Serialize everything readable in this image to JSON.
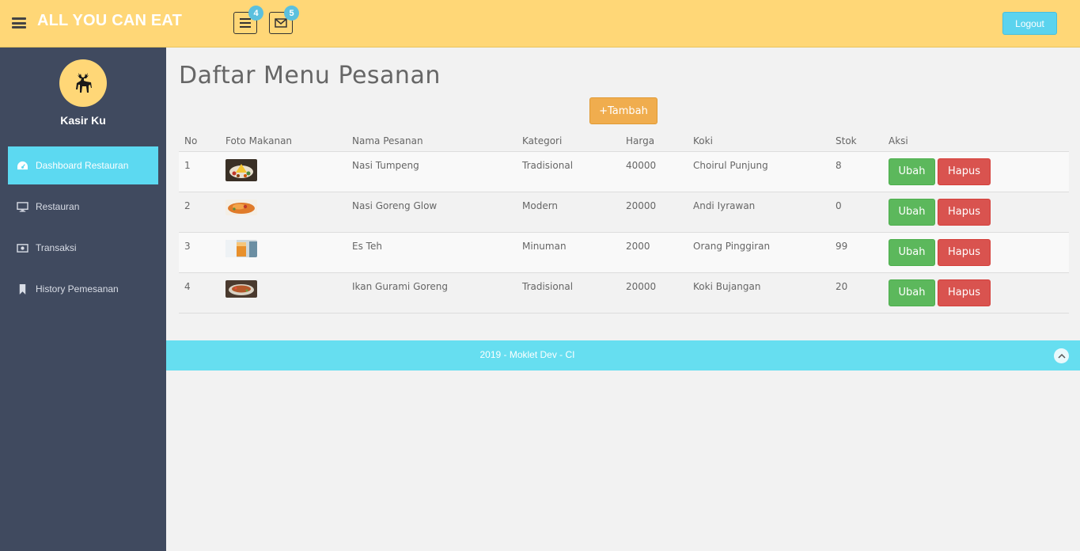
{
  "header": {
    "brand": "ALL YOU CAN EAT",
    "menu_icon": "hamburger-icon",
    "list_icon": "list-icon",
    "list_badge": "4",
    "mail_icon": "envelope-icon",
    "mail_badge": "5",
    "logout_label": "Logout"
  },
  "sidebar": {
    "avatar_icon": "deer-icon",
    "user_name": "Kasir Ku",
    "items": [
      {
        "label": "Dashboard Restauran",
        "icon": "dashboard-icon",
        "active": true
      },
      {
        "label": "Restauran",
        "icon": "monitor-icon",
        "active": false
      },
      {
        "label": "Transaksi",
        "icon": "money-icon",
        "active": false
      },
      {
        "label": "History Pemesanan",
        "icon": "bookmark-icon",
        "active": false
      }
    ]
  },
  "main": {
    "title": "Daftar Menu Pesanan",
    "add_label": "+Tambah",
    "table": {
      "headers": [
        "No",
        "Foto Makanan",
        "Nama Pesanan",
        "Kategori",
        "Harga",
        "Koki",
        "Stok",
        "Aksi"
      ],
      "rows": [
        {
          "no": "1",
          "nama": "Nasi Tumpeng",
          "kategori": "Tradisional",
          "harga": "40000",
          "koki": "Choirul Punjung",
          "stok": "8"
        },
        {
          "no": "2",
          "nama": "Nasi Goreng Glow",
          "kategori": "Modern",
          "harga": "20000",
          "koki": "Andi Iyrawan",
          "stok": "0"
        },
        {
          "no": "3",
          "nama": "Es Teh",
          "kategori": "Minuman",
          "harga": "2000",
          "koki": "Orang Pinggiran",
          "stok": "99"
        },
        {
          "no": "4",
          "nama": "Ikan Gurami Goreng",
          "kategori": "Tradisional",
          "harga": "20000",
          "koki": "Koki Bujangan",
          "stok": "20"
        }
      ],
      "edit_label": "Ubah",
      "delete_label": "Hapus"
    }
  },
  "footer": {
    "text": "2019 - Moklet Dev - CI",
    "to_top_icon": "chevron-up-icon"
  },
  "colors": {
    "header_bg": "#ffd777",
    "sidebar_bg": "#404a5f",
    "accent_cyan": "#5cd9f1",
    "add_orange": "#f0ad4e",
    "edit_green": "#5cb85c",
    "delete_red": "#d9534f"
  }
}
